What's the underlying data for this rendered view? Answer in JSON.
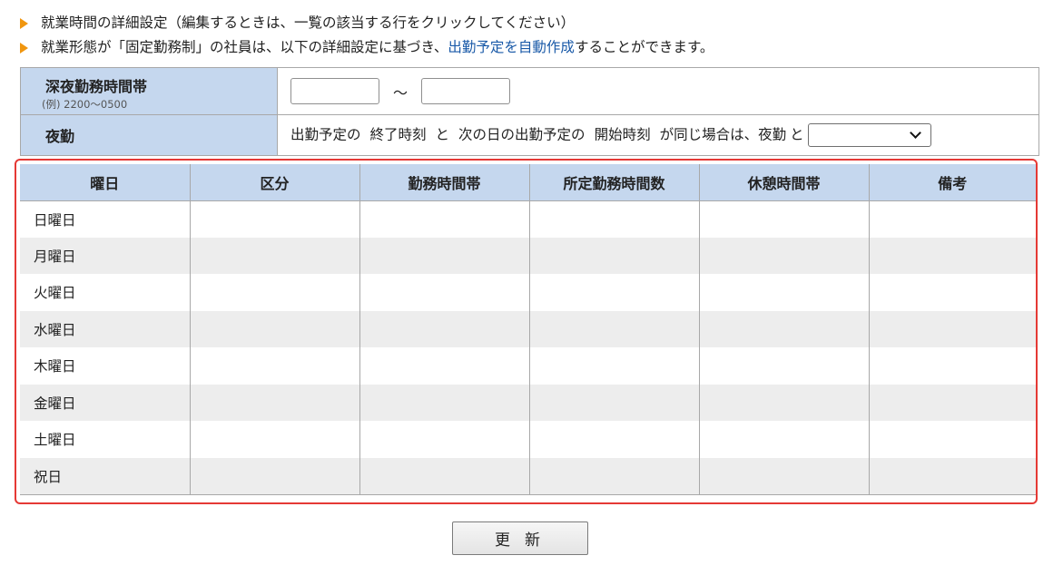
{
  "notes": {
    "line1": "就業時間の詳細設定（編集するときは、一覧の該当する行をクリックしてください）",
    "line2_before": "就業形態が「固定勤務制」の社員は、以下の詳細設定に基づき、",
    "line2_link": "出勤予定を自動作成",
    "line2_after": "することができます。"
  },
  "settings": {
    "late_night": {
      "label": "深夜勤務時間帯",
      "example": "(例) 2200～0500",
      "from_value": "",
      "to_value": "",
      "separator": "～"
    },
    "night_shift": {
      "label": "夜勤",
      "text1": "出勤予定の",
      "text2": "終了時刻",
      "text3": "と",
      "text4": "次の日の出勤予定の",
      "text5": "開始時刻",
      "text6": "が同じ場合は、夜勤",
      "text7": "と",
      "selected": ""
    }
  },
  "table": {
    "headers": [
      "曜日",
      "区分",
      "勤務時間帯",
      "所定勤務時間数",
      "休憩時間帯",
      "備考"
    ],
    "days": [
      "日曜日",
      "月曜日",
      "火曜日",
      "水曜日",
      "木曜日",
      "金曜日",
      "土曜日",
      "祝日"
    ]
  },
  "actions": {
    "update_label": "更新"
  },
  "colors": {
    "header_bg": "#c5d7ee",
    "accent_orange": "#f0960f",
    "link": "#1a5aa8",
    "highlight_border": "#e53935",
    "stripe": "#ededed"
  }
}
